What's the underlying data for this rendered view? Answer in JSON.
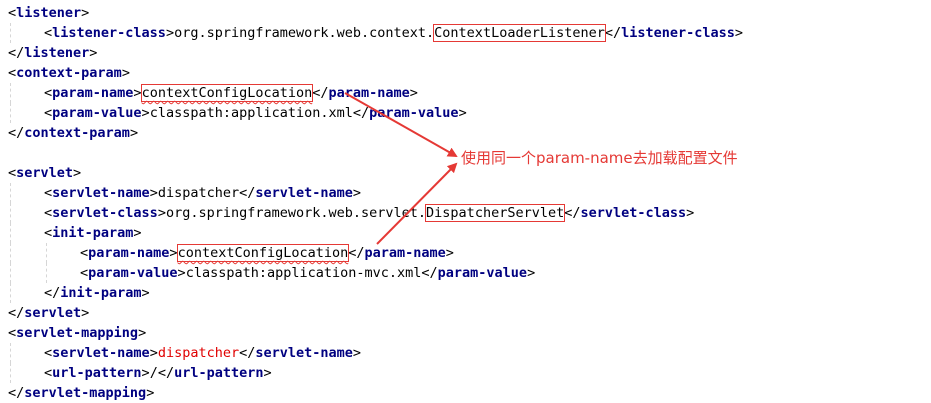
{
  "colors": {
    "tag": "#000080",
    "bracket": "#000000",
    "text": "#000000",
    "highlight_text": "#e00000",
    "annotation": "#e53935"
  },
  "code_lines": [
    {
      "indent": 0,
      "segments": [
        {
          "t": "<",
          "c": "br"
        },
        {
          "t": "listener",
          "c": "tag"
        },
        {
          "t": ">",
          "c": "br"
        }
      ]
    },
    {
      "indent": 1,
      "segments": [
        {
          "t": "<",
          "c": "br"
        },
        {
          "t": "listener-class",
          "c": "tag"
        },
        {
          "t": ">",
          "c": "br"
        },
        {
          "t": "org.springframework.web.context.",
          "c": "txt"
        },
        {
          "t": "ContextLoaderListener",
          "c": "txt",
          "boxed": true
        },
        {
          "t": "</",
          "c": "br"
        },
        {
          "t": "listener-class",
          "c": "tag"
        },
        {
          "t": ">",
          "c": "br"
        }
      ]
    },
    {
      "indent": 0,
      "segments": [
        {
          "t": "</",
          "c": "br"
        },
        {
          "t": "listener",
          "c": "tag"
        },
        {
          "t": ">",
          "c": "br"
        }
      ]
    },
    {
      "indent": 0,
      "segments": [
        {
          "t": "<",
          "c": "br"
        },
        {
          "t": "context-param",
          "c": "tag"
        },
        {
          "t": ">",
          "c": "br"
        }
      ]
    },
    {
      "indent": 1,
      "segments": [
        {
          "t": "<",
          "c": "br"
        },
        {
          "t": "param-name",
          "c": "tag"
        },
        {
          "t": ">",
          "c": "br"
        },
        {
          "t": "contextConfigLocation",
          "c": "txt",
          "boxed": true,
          "squig": true
        },
        {
          "t": "</",
          "c": "br"
        },
        {
          "t": "param-name",
          "c": "tag"
        },
        {
          "t": ">",
          "c": "br"
        }
      ]
    },
    {
      "indent": 1,
      "segments": [
        {
          "t": "<",
          "c": "br"
        },
        {
          "t": "param-value",
          "c": "tag"
        },
        {
          "t": ">",
          "c": "br"
        },
        {
          "t": "classpath:application.xml",
          "c": "txt"
        },
        {
          "t": "</",
          "c": "br"
        },
        {
          "t": "param-value",
          "c": "tag"
        },
        {
          "t": ">",
          "c": "br"
        }
      ]
    },
    {
      "indent": 0,
      "segments": [
        {
          "t": "</",
          "c": "br"
        },
        {
          "t": "context-param",
          "c": "tag"
        },
        {
          "t": ">",
          "c": "br"
        }
      ]
    },
    {
      "indent": 0,
      "segments": []
    },
    {
      "indent": 0,
      "segments": [
        {
          "t": "<",
          "c": "br"
        },
        {
          "t": "servlet",
          "c": "tag"
        },
        {
          "t": ">",
          "c": "br"
        }
      ]
    },
    {
      "indent": 1,
      "segments": [
        {
          "t": "<",
          "c": "br"
        },
        {
          "t": "servlet-name",
          "c": "tag"
        },
        {
          "t": ">",
          "c": "br"
        },
        {
          "t": "dispatcher",
          "c": "txt"
        },
        {
          "t": "</",
          "c": "br"
        },
        {
          "t": "servlet-name",
          "c": "tag"
        },
        {
          "t": ">",
          "c": "br"
        }
      ]
    },
    {
      "indent": 1,
      "segments": [
        {
          "t": "<",
          "c": "br"
        },
        {
          "t": "servlet-class",
          "c": "tag"
        },
        {
          "t": ">",
          "c": "br"
        },
        {
          "t": "org.springframework.web.servlet.",
          "c": "txt"
        },
        {
          "t": "DispatcherServlet",
          "c": "txt",
          "boxed": true
        },
        {
          "t": "</",
          "c": "br"
        },
        {
          "t": "servlet-class",
          "c": "tag"
        },
        {
          "t": ">",
          "c": "br"
        }
      ]
    },
    {
      "indent": 1,
      "segments": [
        {
          "t": "<",
          "c": "br"
        },
        {
          "t": "init-param",
          "c": "tag"
        },
        {
          "t": ">",
          "c": "br"
        }
      ]
    },
    {
      "indent": 2,
      "segments": [
        {
          "t": "<",
          "c": "br"
        },
        {
          "t": "param-name",
          "c": "tag"
        },
        {
          "t": ">",
          "c": "br"
        },
        {
          "t": "contextConfigLocation",
          "c": "txt",
          "boxed": true,
          "squig": true
        },
        {
          "t": "</",
          "c": "br"
        },
        {
          "t": "param-name",
          "c": "tag"
        },
        {
          "t": ">",
          "c": "br"
        }
      ]
    },
    {
      "indent": 2,
      "segments": [
        {
          "t": "<",
          "c": "br"
        },
        {
          "t": "param-value",
          "c": "tag"
        },
        {
          "t": ">",
          "c": "br"
        },
        {
          "t": "classpath:application-mvc.xml",
          "c": "txt"
        },
        {
          "t": "</",
          "c": "br"
        },
        {
          "t": "param-value",
          "c": "tag"
        },
        {
          "t": ">",
          "c": "br"
        }
      ]
    },
    {
      "indent": 1,
      "segments": [
        {
          "t": "</",
          "c": "br"
        },
        {
          "t": "init-param",
          "c": "tag"
        },
        {
          "t": ">",
          "c": "br"
        }
      ]
    },
    {
      "indent": 0,
      "segments": [
        {
          "t": "</",
          "c": "br"
        },
        {
          "t": "servlet",
          "c": "tag"
        },
        {
          "t": ">",
          "c": "br"
        }
      ]
    },
    {
      "indent": 0,
      "segments": [
        {
          "t": "<",
          "c": "br"
        },
        {
          "t": "servlet-mapping",
          "c": "tag"
        },
        {
          "t": ">",
          "c": "br"
        }
      ]
    },
    {
      "indent": 1,
      "segments": [
        {
          "t": "<",
          "c": "br"
        },
        {
          "t": "servlet-name",
          "c": "tag"
        },
        {
          "t": ">",
          "c": "br"
        },
        {
          "t": "dispatcher",
          "c": "err"
        },
        {
          "t": "</",
          "c": "br"
        },
        {
          "t": "servlet-name",
          "c": "tag"
        },
        {
          "t": ">",
          "c": "br"
        }
      ]
    },
    {
      "indent": 1,
      "segments": [
        {
          "t": "<",
          "c": "br"
        },
        {
          "t": "url-pattern",
          "c": "tag"
        },
        {
          "t": ">",
          "c": "br"
        },
        {
          "t": "/",
          "c": "txt"
        },
        {
          "t": "</",
          "c": "br"
        },
        {
          "t": "url-pattern",
          "c": "tag"
        },
        {
          "t": ">",
          "c": "br"
        }
      ]
    },
    {
      "indent": 0,
      "segments": [
        {
          "t": "</",
          "c": "br"
        },
        {
          "t": "servlet-mapping",
          "c": "tag"
        },
        {
          "t": ">",
          "c": "br"
        }
      ]
    }
  ],
  "annotation": {
    "label": "使用同一个param-name去加载配置文件"
  }
}
